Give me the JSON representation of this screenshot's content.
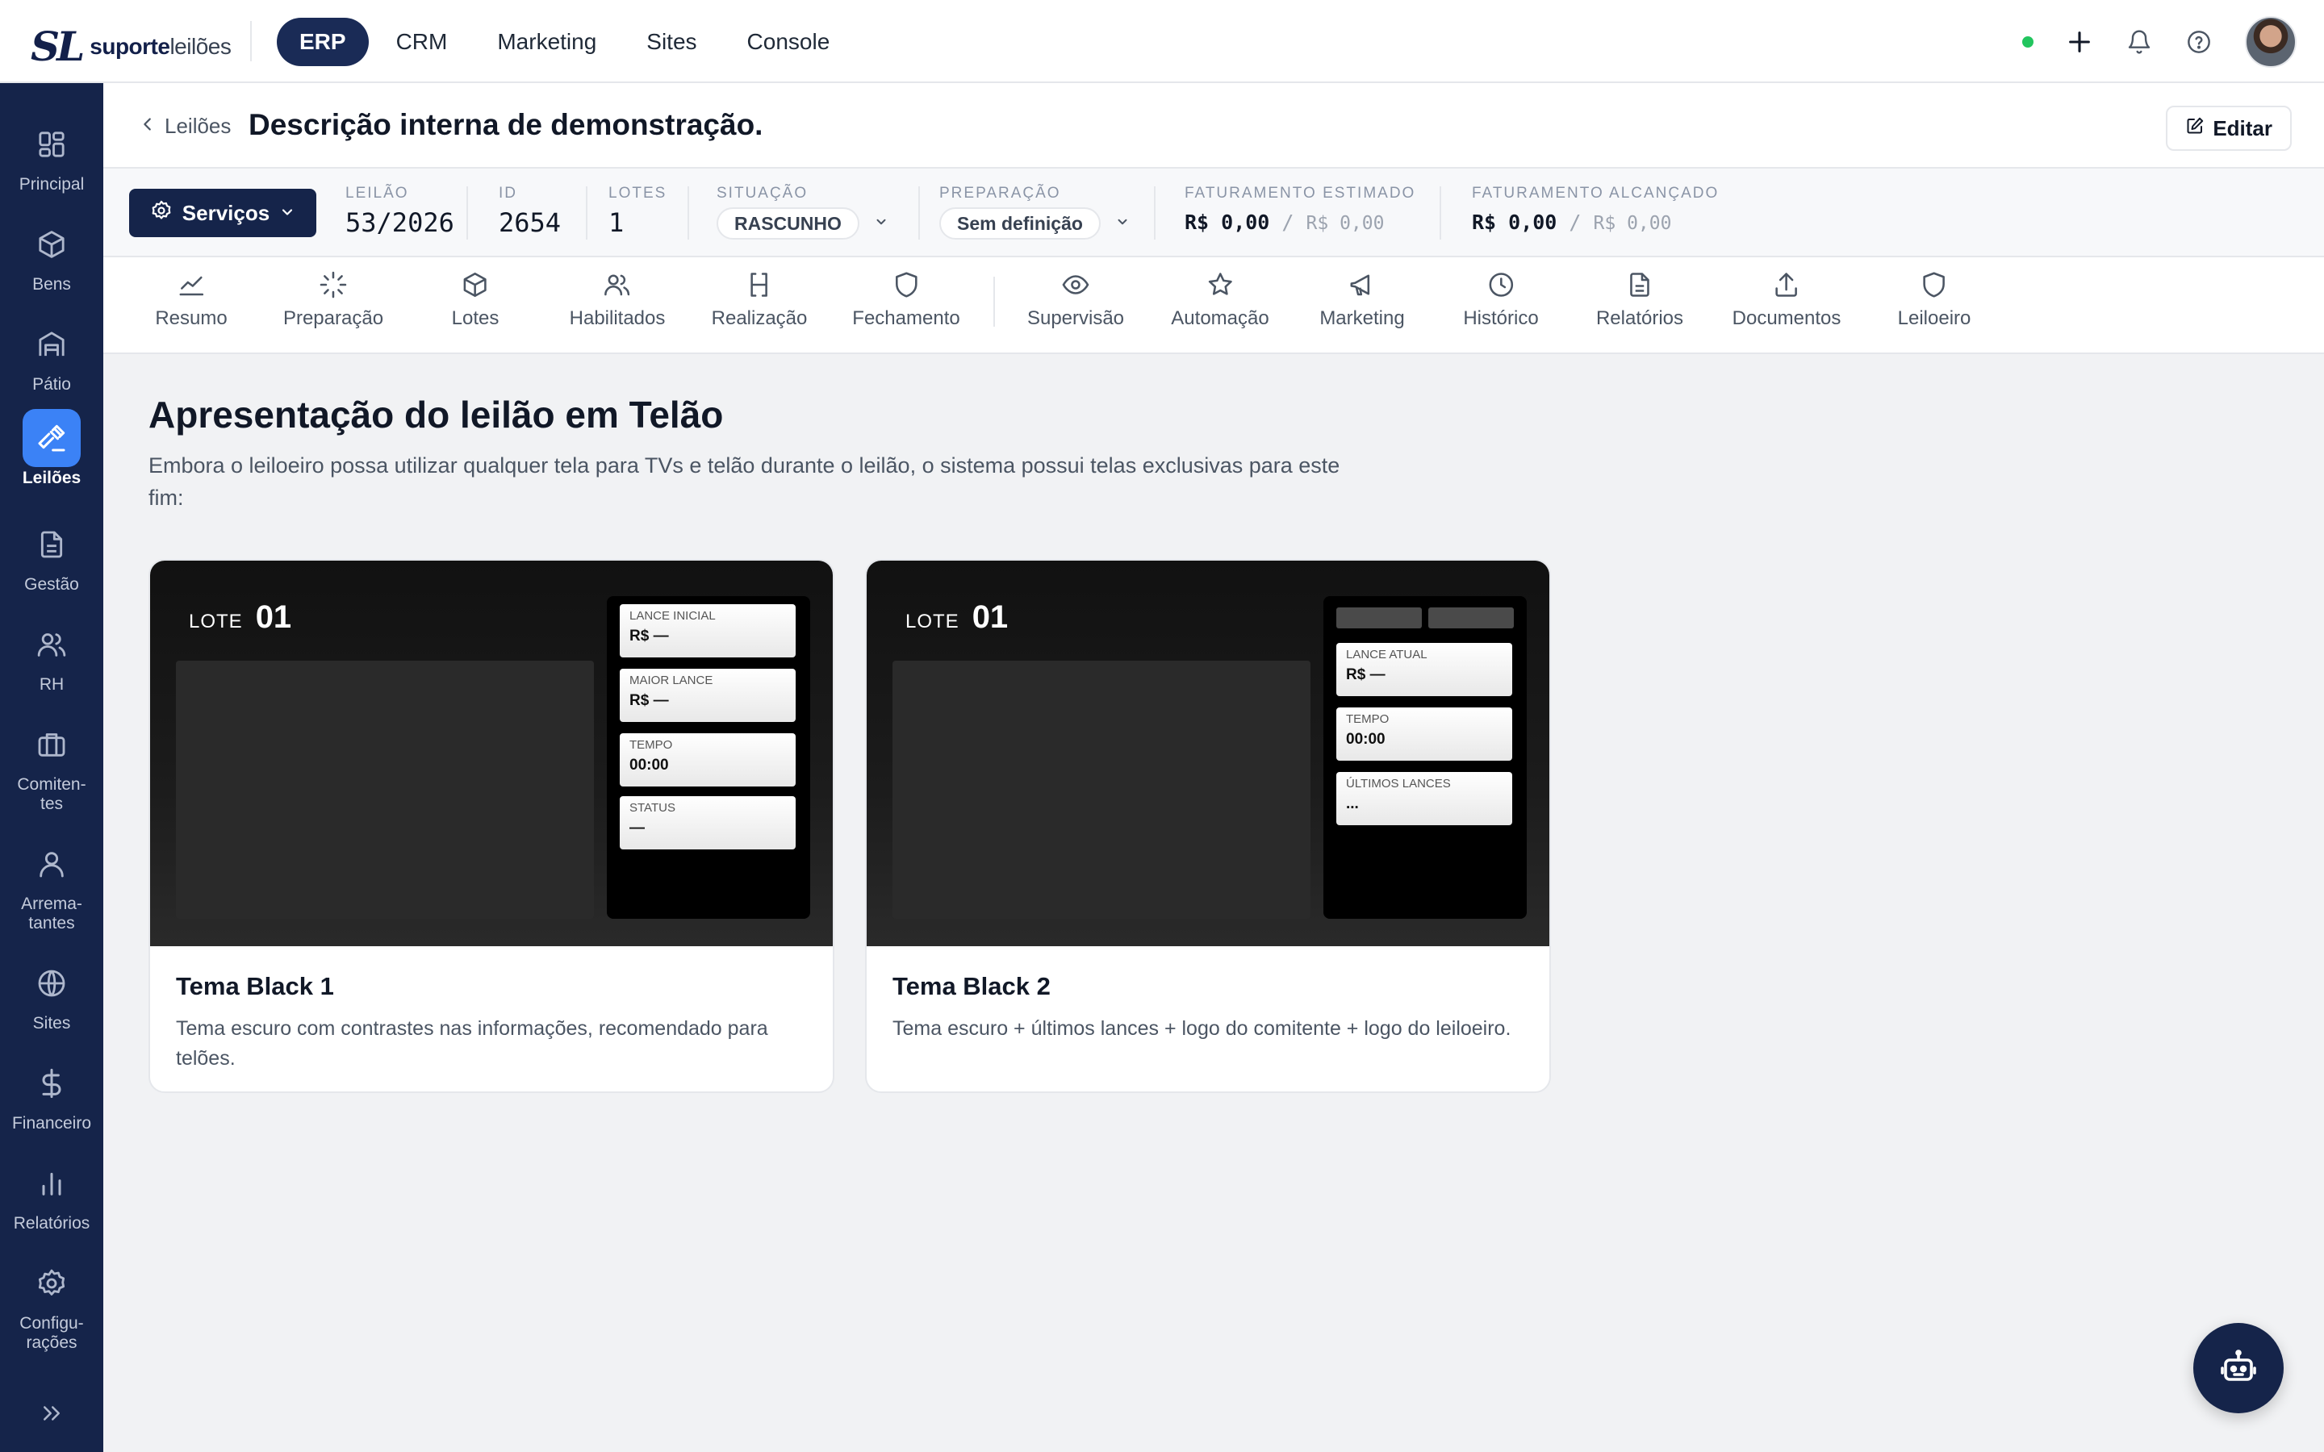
{
  "brand": {
    "mark": "SL",
    "name_bold": "suporte",
    "name_light": "leilões"
  },
  "topnav": [
    {
      "label": "ERP",
      "active": true
    },
    {
      "label": "CRM",
      "active": false
    },
    {
      "label": "Marketing",
      "active": false
    },
    {
      "label": "Sites",
      "active": false
    },
    {
      "label": "Console",
      "active": false
    }
  ],
  "colors": {
    "navy": "#15244a",
    "accent": "#3b82f6",
    "online": "#22c55e"
  },
  "sidebar": [
    {
      "label": "Principal",
      "icon": "grid-icon"
    },
    {
      "label": "Bens",
      "icon": "box-icon"
    },
    {
      "label": "Pátio",
      "icon": "warehouse-icon"
    },
    {
      "label": "Leilões",
      "icon": "gavel-icon",
      "active": true
    },
    {
      "label": "Gestão",
      "icon": "document-icon"
    },
    {
      "label": "RH",
      "icon": "users-icon"
    },
    {
      "label": "Comiten-\ntes",
      "icon": "briefcase-icon"
    },
    {
      "label": "Arrema-\ntantes",
      "icon": "user-icon"
    },
    {
      "label": "Sites",
      "icon": "globe-icon"
    },
    {
      "label": "Financeiro",
      "icon": "dollar-icon"
    },
    {
      "label": "Relatórios",
      "icon": "bar-chart-icon"
    },
    {
      "label": "Configu-\nrações",
      "icon": "gear-icon"
    }
  ],
  "header": {
    "back_label": "Leilões",
    "title": "Descrição interna de demonstração.",
    "edit_label": "Editar"
  },
  "info": {
    "services_label": "Serviços",
    "leilao": {
      "label": "Leilão",
      "value": "53/2026"
    },
    "id": {
      "label": "ID",
      "value": "2654"
    },
    "lotes": {
      "label": "Lotes",
      "value": "1"
    },
    "situacao": {
      "label": "Situação",
      "value": "RASCUNHO"
    },
    "preparacao": {
      "label": "Preparação",
      "value": "Sem definição"
    },
    "fat_estimado": {
      "label": "Faturamento Estimado",
      "value": "R$ 0,00",
      "sep": "/",
      "sub": "R$ 0,00"
    },
    "fat_alcancado": {
      "label": "Faturamento Alcançado",
      "value": "R$ 0,00",
      "sep": "/",
      "sub": "R$ 0,00"
    }
  },
  "tabs": [
    {
      "label": "Resumo",
      "icon": "trend-icon"
    },
    {
      "label": "Preparação",
      "icon": "loader-icon"
    },
    {
      "label": "Lotes",
      "icon": "box-icon"
    },
    {
      "label": "Habilitados",
      "icon": "users-icon"
    },
    {
      "label": "Realização",
      "icon": "gavel-icon"
    },
    {
      "label": "Fechamento",
      "icon": "shield-icon"
    },
    {
      "label": "Supervisão",
      "icon": "eye-icon"
    },
    {
      "label": "Automação",
      "icon": "star-icon"
    },
    {
      "label": "Marketing",
      "icon": "megaphone-icon"
    },
    {
      "label": "Histórico",
      "icon": "clock-icon"
    },
    {
      "label": "Relatórios",
      "icon": "document-icon"
    },
    {
      "label": "Documentos",
      "icon": "upload-icon"
    },
    {
      "label": "Leiloeiro",
      "icon": "shield-icon"
    }
  ],
  "main": {
    "title": "Apresentação do leilão em Telão",
    "description": "Embora o leiloeiro possa utilizar qualquer tela para TVs e telão durante o leilão, o sistema possui telas exclusivas para este fim:",
    "cards": [
      {
        "title": "Tema Black 1",
        "description": "Tema escuro com contrastes nas informações, recomendado para telões.",
        "lote_label": "LOTE",
        "lote_number": "01",
        "panel": [
          {
            "label": "Lance inicial",
            "value": "R$ —"
          },
          {
            "label": "Maior lance",
            "value": "R$ —"
          },
          {
            "label": "Tempo",
            "value": "00:00"
          },
          {
            "label": "Status",
            "value": "—"
          }
        ]
      },
      {
        "title": "Tema Black 2",
        "description": "Tema escuro + últimos lances + logo do comitente + logo do leiloeiro.",
        "lote_label": "LOTE",
        "lote_number": "01",
        "panel": [
          {
            "label": "Lance atual",
            "value": "R$ —"
          },
          {
            "label": "Tempo",
            "value": "00:00"
          },
          {
            "label": "Últimos lances",
            "value": "..."
          }
        ]
      }
    ]
  }
}
